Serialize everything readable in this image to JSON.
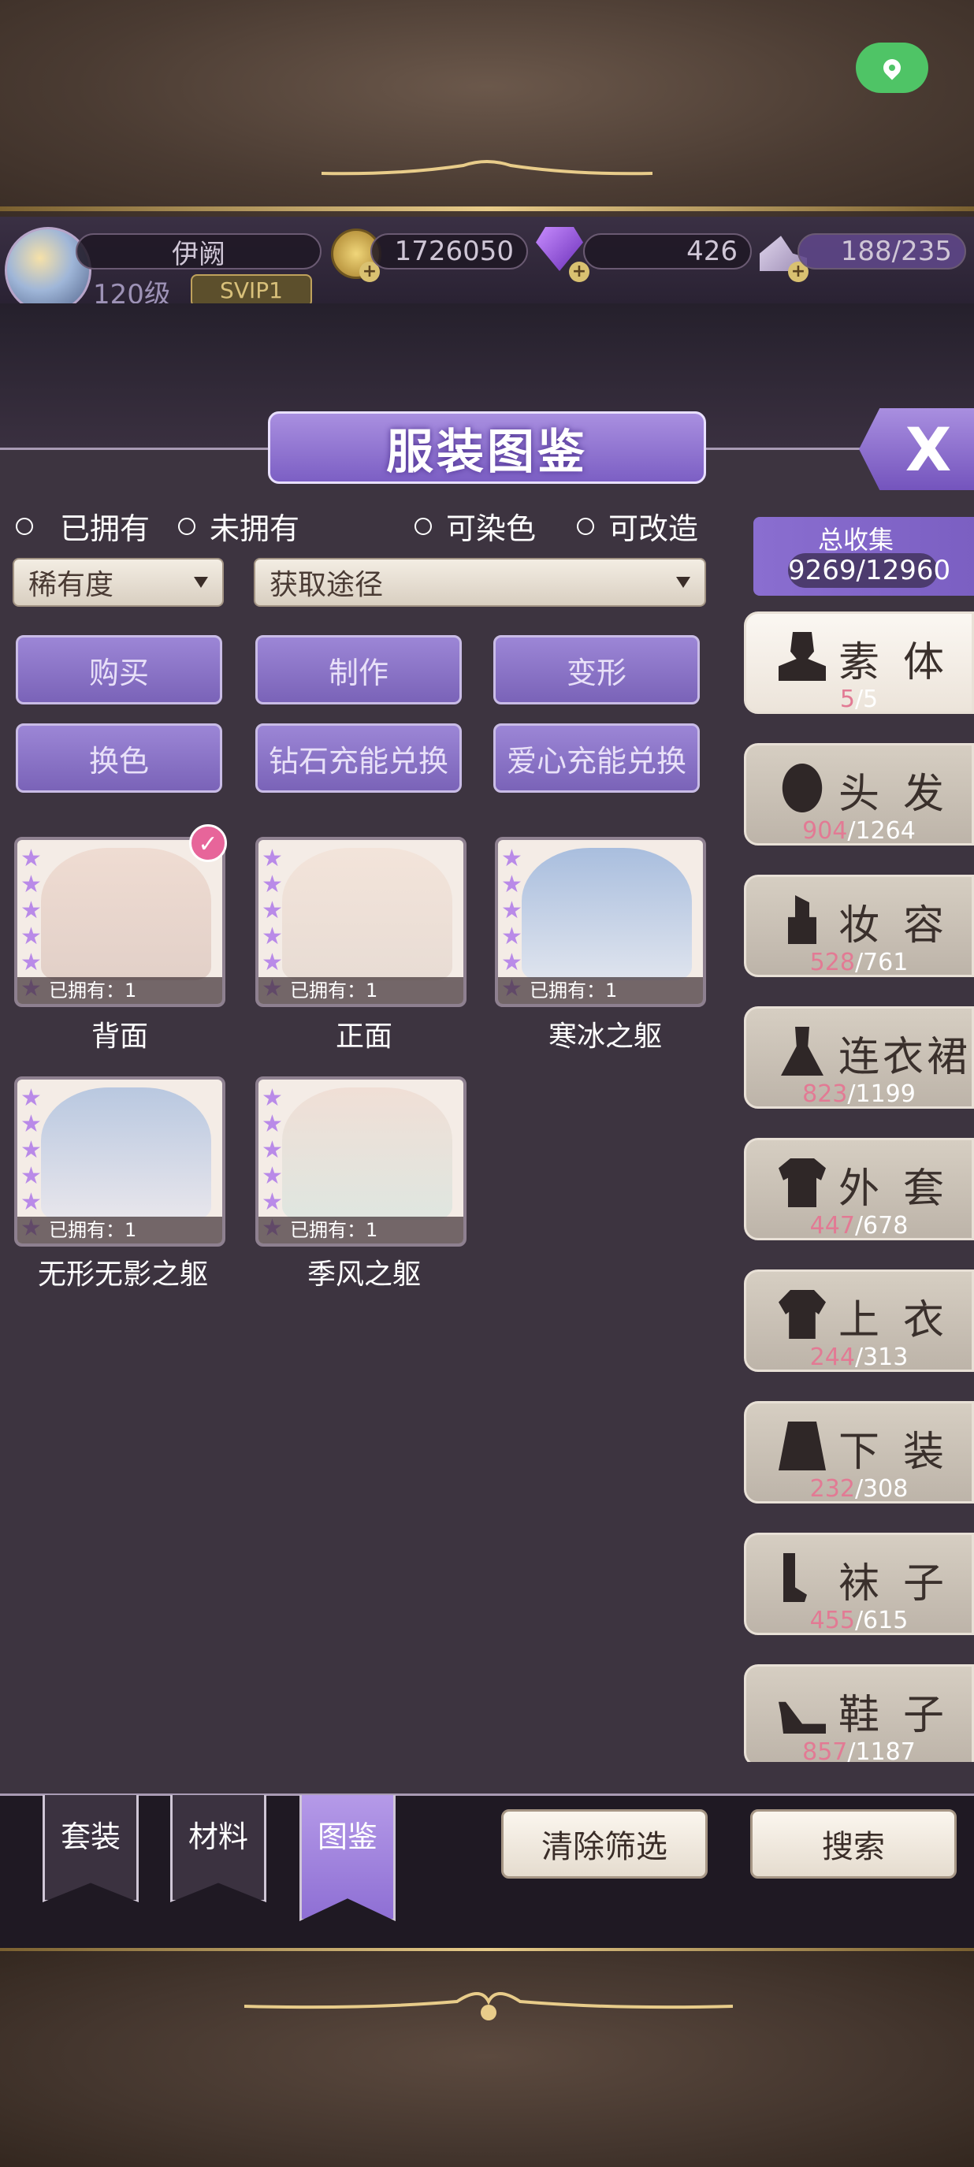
{
  "player": {
    "name": "伊阙",
    "level": "120级",
    "vip": "SVIP1",
    "gold": "1726050",
    "diamonds": "426",
    "stamina": "188/235"
  },
  "panel": {
    "title": "服装图鉴",
    "close_label": "X"
  },
  "filters": {
    "radios": [
      "已拥有",
      "未拥有",
      "可染色",
      "可改造"
    ],
    "rarity_select": "稀有度",
    "source_select": "获取途径",
    "buttons": [
      "购买",
      "制作",
      "变形",
      "换色",
      "钻石充能兑换",
      "爱心充能兑换"
    ]
  },
  "items": [
    {
      "name": "背面",
      "owned_label": "已拥有：1",
      "stars": 6,
      "checked": true
    },
    {
      "name": "正面",
      "owned_label": "已拥有：1",
      "stars": 6,
      "checked": false
    },
    {
      "name": "寒冰之躯",
      "owned_label": "已拥有：1",
      "stars": 6,
      "checked": false
    },
    {
      "name": "无形无影之躯",
      "owned_label": "已拥有：1",
      "stars": 6,
      "checked": false
    },
    {
      "name": "季风之躯",
      "owned_label": "已拥有：1",
      "stars": 6,
      "checked": false
    }
  ],
  "collection": {
    "label": "总收集",
    "value": "9269/12960"
  },
  "categories": [
    {
      "label": "素体",
      "have": "5",
      "total": "/5",
      "icon": "body-icon",
      "selected": true
    },
    {
      "label": "头发",
      "have": "904",
      "total": "/1264",
      "icon": "hair-icon",
      "selected": false
    },
    {
      "label": "妆容",
      "have": "528",
      "total": "/761",
      "icon": "lipstick-icon",
      "selected": false
    },
    {
      "label": "连衣裙",
      "have": "823",
      "total": "/1199",
      "icon": "dress-icon",
      "selected": false
    },
    {
      "label": "外套",
      "have": "447",
      "total": "/678",
      "icon": "coat-icon",
      "selected": false
    },
    {
      "label": "上衣",
      "have": "244",
      "total": "/313",
      "icon": "top-icon",
      "selected": false
    },
    {
      "label": "下装",
      "have": "232",
      "total": "/308",
      "icon": "skirt-icon",
      "selected": false
    },
    {
      "label": "袜子",
      "have": "455",
      "total": "/615",
      "icon": "socks-icon",
      "selected": false
    },
    {
      "label": "鞋子",
      "have": "857",
      "total": "/1187",
      "icon": "shoe-icon",
      "selected": false
    }
  ],
  "bottom_nav": {
    "tabs": [
      "套装",
      "材料",
      "图鉴"
    ],
    "clear_filter": "清除筛选",
    "search": "搜索"
  },
  "colors": {
    "accent_purple": "#8a6ed0",
    "owned_count": "#e27a94",
    "location_green": "#4fc466"
  }
}
